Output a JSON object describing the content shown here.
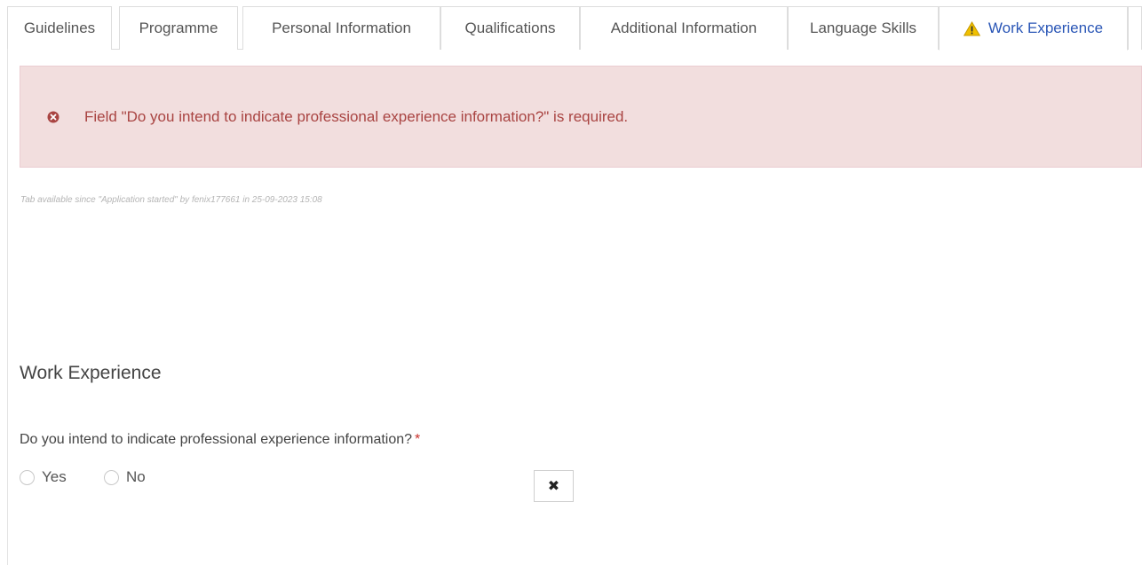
{
  "tabs": [
    {
      "label": "Guidelines"
    },
    {
      "label": "Programme"
    },
    {
      "label": "Personal Information"
    },
    {
      "label": "Qualifications"
    },
    {
      "label": "Additional Information"
    },
    {
      "label": "Language Skills"
    },
    {
      "label": "Work Experience",
      "icon": "warning-icon",
      "active": true
    }
  ],
  "alert": {
    "icon": "error-circle-icon",
    "message": "Field \"Do you intend to indicate professional experience information?\" is required.",
    "color": "#a94442",
    "background": "#f2dede"
  },
  "meta": {
    "availability": "Tab available since \"Application started\" by fenix177661 in 25-09-2023 15:08"
  },
  "section": {
    "title": "Work Experience"
  },
  "question": {
    "label": "Do you intend to indicate professional experience information?",
    "required_mark": "*",
    "options": [
      "Yes",
      "No"
    ],
    "clear_icon": "close-icon",
    "clear_label": "✖"
  },
  "colors": {
    "accent": "#2a56b6",
    "warning": "#f0c000",
    "required": "#c9302c"
  }
}
